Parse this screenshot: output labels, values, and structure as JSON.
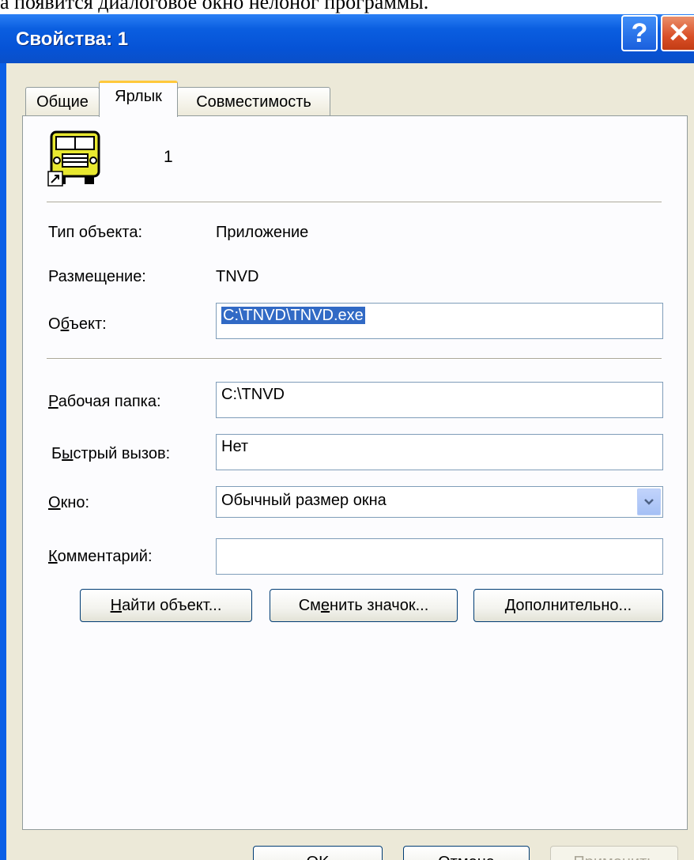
{
  "document": {
    "caption_fragment": "а появится диалоговое окно  нелоног программы."
  },
  "window": {
    "title": "Свойства: 1"
  },
  "titlebar": {
    "help_glyph": "?",
    "close_glyph": "✕"
  },
  "tabs": [
    {
      "label": "Общие",
      "active": false
    },
    {
      "label": "Ярлык",
      "active": true
    },
    {
      "label": "Совместимость",
      "active": false
    }
  ],
  "shortcut": {
    "name": "1",
    "type_label": "Тип объекта:",
    "type_value": "Приложение",
    "location_label": "Размещение:",
    "location_value": "TNVD",
    "target_label_pre": "О",
    "target_label_u": "б",
    "target_label_post": "ъект:",
    "target_value": "C:\\TNVD\\TNVD.exe",
    "workdir_label_u": "Р",
    "workdir_label_post": "абочая папка:",
    "workdir_value": "C:\\TNVD",
    "hotkey_label_pre": "Б",
    "hotkey_label_u": "ы",
    "hotkey_label_post": "стрый вызов:",
    "hotkey_value": "Нет",
    "run_label_u": "О",
    "run_label_post": "кно:",
    "run_value": "Обычный размер окна",
    "comment_label_u": "К",
    "comment_label_post": "омментарий:",
    "comment_value": ""
  },
  "buttons": {
    "find_u": "Н",
    "find_post": "айти объект...",
    "change_icon_pre": "См",
    "change_icon_u": "е",
    "change_icon_post": "нить значок...",
    "advanced_u": "Д",
    "advanced_post": "ополнительно...",
    "ok": "OK",
    "cancel": "Отмена",
    "apply_pre": "При",
    "apply_u": "м",
    "apply_post": "енить"
  },
  "colors": {
    "titlebar": "#0a5fe6",
    "selection": "#316ac5",
    "active_tab_accent": "#ffc83c"
  },
  "icons": {
    "app": "bus-shortcut-icon",
    "dropdown": "chevron-down-icon"
  }
}
